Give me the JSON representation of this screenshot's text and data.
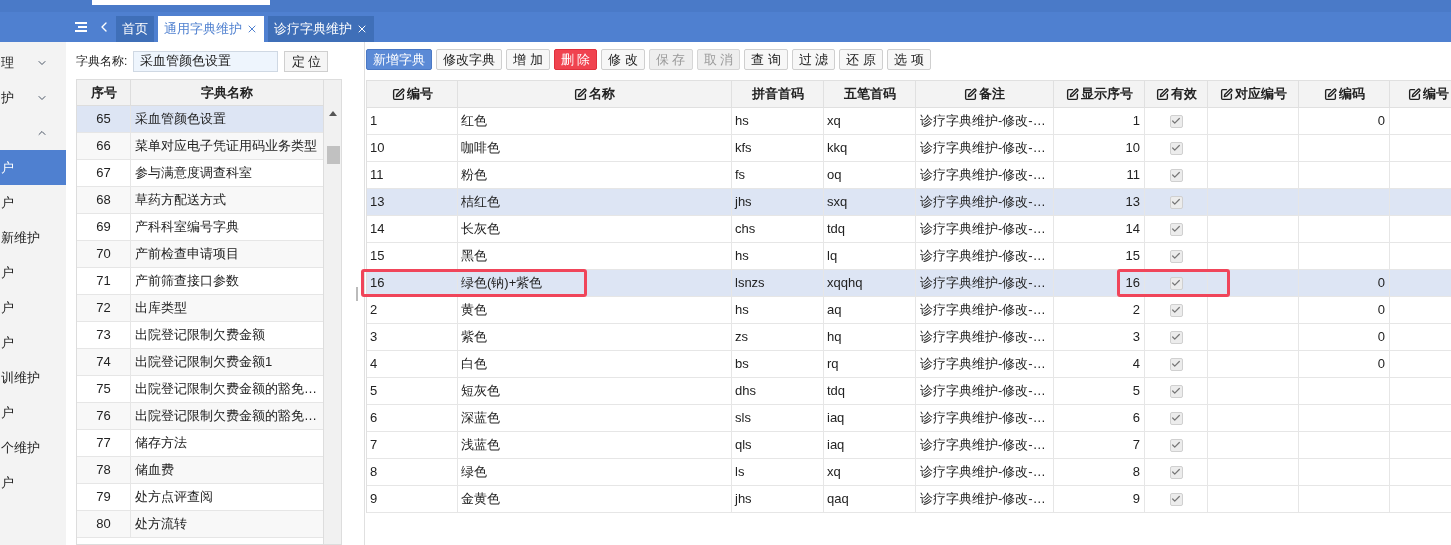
{
  "nav": {
    "tabs": [
      {
        "label": "首页",
        "selected": false,
        "closable": false
      },
      {
        "label": "通用字典维护",
        "selected": true,
        "closable": true
      },
      {
        "label": "诊疗字典维护",
        "selected": false,
        "closable": true
      }
    ]
  },
  "sidebar": {
    "items": [
      {
        "label": "理",
        "selected": false,
        "expanded": false
      },
      {
        "label": "护",
        "selected": false,
        "expanded": false
      },
      {
        "selected": false,
        "expanded": true
      },
      {
        "label": "户",
        "selected": true
      },
      {
        "label": "户",
        "selected": false
      },
      {
        "label": "新维护",
        "selected": false
      },
      {
        "label": "户",
        "selected": false
      },
      {
        "label": "户",
        "selected": false
      },
      {
        "label": "户",
        "selected": false
      },
      {
        "label": "训维护",
        "selected": false
      },
      {
        "label": "户",
        "selected": false
      },
      {
        "label": "个维护",
        "selected": false
      },
      {
        "label": "户",
        "selected": false
      }
    ]
  },
  "dict_search": {
    "label": "字典名称:",
    "value": "采血管颜色设置",
    "button": "定 位"
  },
  "dict_table": {
    "columns": [
      "序号",
      "字典名称"
    ],
    "rows": [
      {
        "no": "65",
        "name": "采血管颜色设置",
        "selected": true
      },
      {
        "no": "66",
        "name": "菜单对应电子凭证用码业务类型",
        "selected": false
      },
      {
        "no": "67",
        "name": "参与满意度调查科室",
        "selected": false
      },
      {
        "no": "68",
        "name": "草药方配送方式",
        "selected": false
      },
      {
        "no": "69",
        "name": "产科科室编号字典",
        "selected": false
      },
      {
        "no": "70",
        "name": "产前检查申请项目",
        "selected": false
      },
      {
        "no": "71",
        "name": "产前筛查接口参数",
        "selected": false
      },
      {
        "no": "72",
        "name": "出库类型",
        "selected": false
      },
      {
        "no": "73",
        "name": "出院登记限制欠费金额",
        "selected": false
      },
      {
        "no": "74",
        "name": "出院登记限制欠费金额1",
        "selected": false
      },
      {
        "no": "75",
        "name": "出院登记限制欠费金额的豁免…",
        "selected": false
      },
      {
        "no": "76",
        "name": "出院登记限制欠费金额的豁免…",
        "selected": false
      },
      {
        "no": "77",
        "name": "储存方法",
        "selected": false
      },
      {
        "no": "78",
        "name": "储血费",
        "selected": false
      },
      {
        "no": "79",
        "name": "处方点评查阅",
        "selected": false
      },
      {
        "no": "80",
        "name": "处方流转",
        "selected": false
      }
    ]
  },
  "toolbar": [
    {
      "label": "新增字典",
      "kind": "primary",
      "disabled": false
    },
    {
      "label": "修改字典",
      "kind": "normal",
      "disabled": false
    },
    {
      "label": "增 加",
      "kind": "normal",
      "disabled": false
    },
    {
      "label": "删 除",
      "kind": "danger",
      "disabled": false
    },
    {
      "label": "修 改",
      "kind": "normal",
      "disabled": false
    },
    {
      "label": "保 存",
      "kind": "normal",
      "disabled": true
    },
    {
      "label": "取 消",
      "kind": "normal",
      "disabled": true
    },
    {
      "label": "查 询",
      "kind": "normal",
      "disabled": false
    },
    {
      "label": "过 滤",
      "kind": "normal",
      "disabled": false
    },
    {
      "label": "还 原",
      "kind": "normal",
      "disabled": false
    },
    {
      "label": "选 项",
      "kind": "normal",
      "disabled": false
    }
  ],
  "table": {
    "columns": [
      {
        "label": "编号",
        "editable": true
      },
      {
        "label": "名称",
        "editable": true
      },
      {
        "label": "拼音首码",
        "editable": false
      },
      {
        "label": "五笔首码",
        "editable": false
      },
      {
        "label": "备注",
        "editable": true
      },
      {
        "label": "显示序号",
        "editable": true
      },
      {
        "label": "有效",
        "editable": true
      },
      {
        "label": "对应编号",
        "editable": true
      },
      {
        "label": "编码",
        "editable": true
      },
      {
        "label": "编号",
        "editable": true
      }
    ],
    "rows": [
      {
        "id": "1",
        "name": "红色",
        "py": "hs",
        "wb": "xq",
        "note": "诊疗字典维护-修改-…",
        "order": "1",
        "valid": true,
        "code": "0",
        "selected": false,
        "outlined": false
      },
      {
        "id": "10",
        "name": "咖啡色",
        "py": "kfs",
        "wb": "kkq",
        "note": "诊疗字典维护-修改-…",
        "order": "10",
        "valid": true,
        "selected": false,
        "outlined": false
      },
      {
        "id": "11",
        "name": "粉色",
        "py": "fs",
        "wb": "oq",
        "note": "诊疗字典维护-修改-…",
        "order": "11",
        "valid": true,
        "selected": false,
        "outlined": false
      },
      {
        "id": "13",
        "name": "桔红色",
        "py": "jhs",
        "wb": "sxq",
        "note": "诊疗字典维护-修改-…",
        "order": "13",
        "valid": true,
        "selected": true,
        "outlined": false
      },
      {
        "id": "14",
        "name": "长灰色",
        "py": "chs",
        "wb": "tdq",
        "note": "诊疗字典维护-修改-…",
        "order": "14",
        "valid": true,
        "selected": false,
        "outlined": false
      },
      {
        "id": "15",
        "name": "黑色",
        "py": "hs",
        "wb": "lq",
        "note": "诊疗字典维护-修改-…",
        "order": "15",
        "valid": true,
        "selected": false,
        "outlined": false
      },
      {
        "id": "16",
        "name": "绿色(钠)+紫色",
        "py": "lsnzs",
        "wb": "xqqhq",
        "note": "诊疗字典维护-修改-…",
        "order": "16",
        "valid": true,
        "code": "0",
        "selected": true,
        "outlined": true
      },
      {
        "id": "2",
        "name": "黄色",
        "py": "hs",
        "wb": "aq",
        "note": "诊疗字典维护-修改-…",
        "order": "2",
        "valid": true,
        "code": "0",
        "selected": false,
        "outlined": false
      },
      {
        "id": "3",
        "name": "紫色",
        "py": "zs",
        "wb": "hq",
        "note": "诊疗字典维护-修改-…",
        "order": "3",
        "valid": true,
        "code": "0",
        "selected": false,
        "outlined": false
      },
      {
        "id": "4",
        "name": "白色",
        "py": "bs",
        "wb": "rq",
        "note": "诊疗字典维护-修改-…",
        "order": "4",
        "valid": true,
        "code": "0",
        "selected": false,
        "outlined": false
      },
      {
        "id": "5",
        "name": "短灰色",
        "py": "dhs",
        "wb": "tdq",
        "note": "诊疗字典维护-修改-…",
        "order": "5",
        "valid": true,
        "selected": false,
        "outlined": false
      },
      {
        "id": "6",
        "name": "深蓝色",
        "py": "sls",
        "wb": "iaq",
        "note": "诊疗字典维护-修改-…",
        "order": "6",
        "valid": true,
        "selected": false,
        "outlined": false
      },
      {
        "id": "7",
        "name": "浅蓝色",
        "py": "qls",
        "wb": "iaq",
        "note": "诊疗字典维护-修改-…",
        "order": "7",
        "valid": true,
        "selected": false,
        "outlined": false
      },
      {
        "id": "8",
        "name": "绿色",
        "py": "ls",
        "wb": "xq",
        "note": "诊疗字典维护-修改-…",
        "order": "8",
        "valid": true,
        "selected": false,
        "outlined": false
      },
      {
        "id": "9",
        "name": "金黄色",
        "py": "jhs",
        "wb": "qaq",
        "note": "诊疗字典维护-修改-…",
        "order": "9",
        "valid": true,
        "selected": false,
        "outlined": false
      }
    ]
  }
}
